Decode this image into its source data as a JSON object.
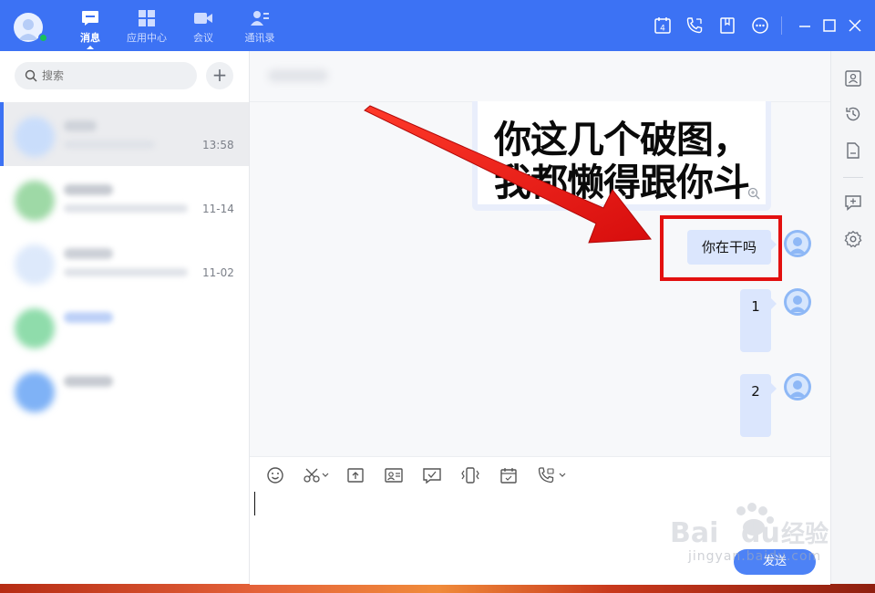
{
  "nav": {
    "tabs": [
      {
        "label": "消息",
        "icon": "message-icon"
      },
      {
        "label": "应用中心",
        "icon": "apps-icon"
      },
      {
        "label": "会议",
        "icon": "video-icon"
      },
      {
        "label": "通讯录",
        "icon": "contacts-icon"
      }
    ],
    "calendar_day": "4"
  },
  "search": {
    "placeholder": "搜索"
  },
  "conversations": [
    {
      "time": "13:58",
      "selected": true
    },
    {
      "time": "11-14",
      "selected": false
    },
    {
      "time": "11-02",
      "selected": false
    },
    {
      "time": "",
      "selected": false
    },
    {
      "time": "",
      "selected": false
    }
  ],
  "sticker": {
    "line1": "你这几个破图，",
    "line2": "我都懒得跟你斗"
  },
  "messages": [
    {
      "text": "你在干吗"
    },
    {
      "text": "1"
    },
    {
      "text": "2"
    }
  ],
  "composer": {
    "send_label": "发送"
  },
  "watermark": {
    "url": "jingyan.baidu.com"
  },
  "colors": {
    "topbar": "#3c72f4",
    "bubble": "#dbe6fd",
    "highlight": "#e3100f",
    "online": "#18c05a"
  }
}
